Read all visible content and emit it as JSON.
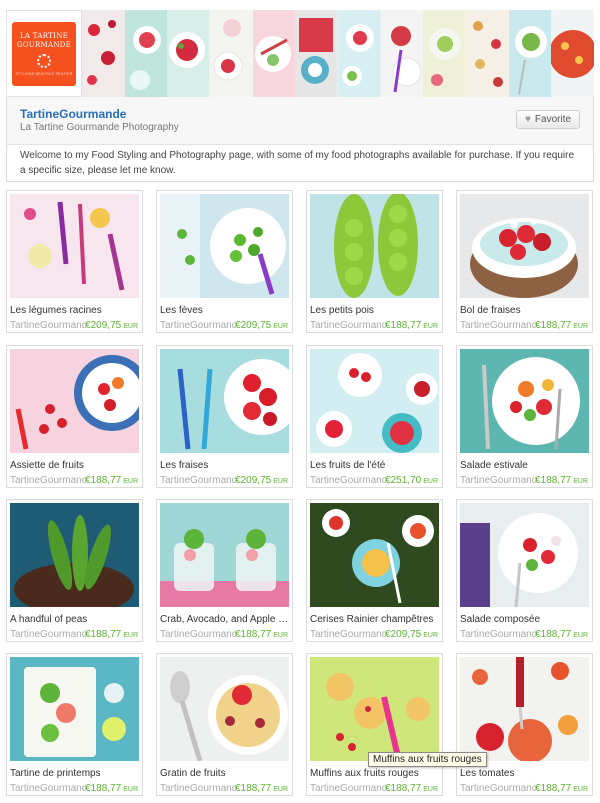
{
  "header": {
    "logo_line1": "LA TARTINE",
    "logo_line2": "GOURMANDE",
    "logo_tagline": "STYLISME BEATRICE PEILTIER"
  },
  "shop": {
    "name": "TartineGourmande",
    "subtitle": "La Tartine Gourmande Photography",
    "favorite_label": "Favorite",
    "description": "Welcome to my Food Styling and Photography page, with some of my food photographs available for purchase. If you require a specific size, please let me know."
  },
  "listings": [
    {
      "title": "Les légumes racines",
      "shop": "TartineGourmande",
      "price": "€209,75",
      "currency": "EUR"
    },
    {
      "title": "Les fèves",
      "shop": "TartineGourmande",
      "price": "€209,75",
      "currency": "EUR"
    },
    {
      "title": "Les petits pois",
      "shop": "TartineGourmande",
      "price": "€188,77",
      "currency": "EUR"
    },
    {
      "title": "Bol de fraises",
      "shop": "TartineGourmande",
      "price": "€188,77",
      "currency": "EUR"
    },
    {
      "title": "Assiette de fruits",
      "shop": "TartineGourmande",
      "price": "€188,77",
      "currency": "EUR"
    },
    {
      "title": "Les fraises",
      "shop": "TartineGourmande",
      "price": "€209,75",
      "currency": "EUR"
    },
    {
      "title": "Les fruits de l'été",
      "shop": "TartineGourmande",
      "price": "€251,70",
      "currency": "EUR"
    },
    {
      "title": "Salade estivale",
      "shop": "TartineGourmande",
      "price": "€188,77",
      "currency": "EUR"
    },
    {
      "title": "A handful of peas",
      "shop": "TartineGourmande",
      "price": "€188,77",
      "currency": "EUR"
    },
    {
      "title": "Crab, Avocado, and Apple V...",
      "shop": "TartineGourmande",
      "price": "€188,77",
      "currency": "EUR"
    },
    {
      "title": "Cerises Rainier champêtres",
      "shop": "TartineGourmande",
      "price": "€209,75",
      "currency": "EUR"
    },
    {
      "title": "Salade composée",
      "shop": "TartineGourmande",
      "price": "€188,77",
      "currency": "EUR"
    },
    {
      "title": "Tartine de printemps",
      "shop": "TartineGourmande",
      "price": "€188,77",
      "currency": "EUR"
    },
    {
      "title": "Gratin de fruits",
      "shop": "TartineGourmande",
      "price": "€188,77",
      "currency": "EUR"
    },
    {
      "title": "Muffins aux fruits rouges",
      "shop": "TartineGourmande",
      "price": "€188,77",
      "currency": "EUR"
    },
    {
      "title": "Les tomates",
      "shop": "TartineGourmande",
      "price": "€188,77",
      "currency": "EUR"
    }
  ],
  "tooltip": "Muffins aux fruits rouges",
  "colors": {
    "brand": "#f4511e",
    "link": "#2a6ebb",
    "price": "#5fb336"
  }
}
